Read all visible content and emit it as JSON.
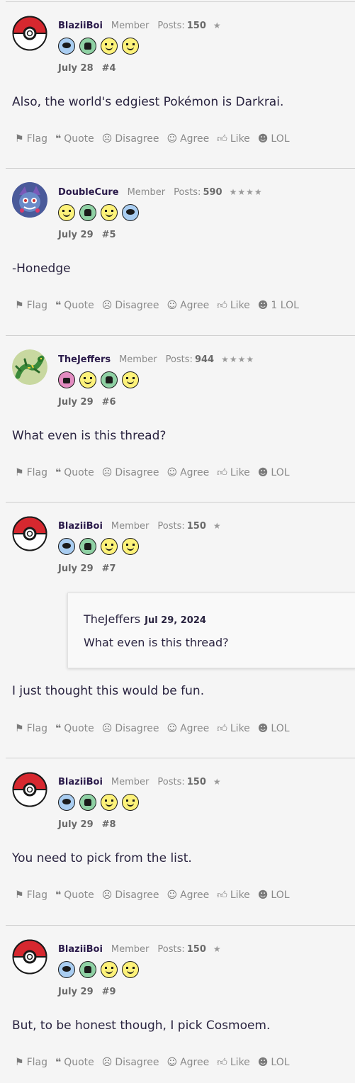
{
  "actions": {
    "flag": "Flag",
    "quote": "Quote",
    "disagree": "Disagree",
    "agree": "Agree",
    "like": "Like",
    "lol": "LOL",
    "lol_counted": "1 LOL"
  },
  "posts": [
    {
      "username": "BlaziiBoi",
      "role": "Member",
      "posts_label": "Posts:",
      "posts_count": "150",
      "stars": "★",
      "badges": [
        "speech-bubble-icon",
        "thumbs-up-icon",
        "wink-face-icon",
        "smile-face-icon"
      ],
      "date": "July 28",
      "number": "#4",
      "body": "Also, the world's edgiest Pokémon is Darkrai."
    },
    {
      "username": "DoubleCure",
      "role": "Member",
      "posts_label": "Posts:",
      "posts_count": "590",
      "stars": "★★★★",
      "badges": [
        "wink-face-icon",
        "thumbs-up-icon",
        "smile-face-icon",
        "speech-bubble-icon"
      ],
      "date": "July 29",
      "number": "#5",
      "body": "-Honedge"
    },
    {
      "username": "TheJeffers",
      "role": "Member",
      "posts_label": "Posts:",
      "posts_count": "944",
      "stars": "★★★★",
      "badges": [
        "cake-icon",
        "wink-face-icon",
        "thumbs-up-icon",
        "smile-face-icon"
      ],
      "date": "July 29",
      "number": "#6",
      "body": "What even is this thread?"
    },
    {
      "username": "BlaziiBoi",
      "role": "Member",
      "posts_label": "Posts:",
      "posts_count": "150",
      "stars": "★",
      "badges": [
        "speech-bubble-icon",
        "thumbs-up-icon",
        "wink-face-icon",
        "smile-face-icon"
      ],
      "date": "July 29",
      "number": "#7",
      "quote": {
        "author": "TheJeffers",
        "date": "Jul 29, 2024",
        "text": "What even is this thread?"
      },
      "body": "I just thought this would be fun."
    },
    {
      "username": "BlaziiBoi",
      "role": "Member",
      "posts_label": "Posts:",
      "posts_count": "150",
      "stars": "★",
      "badges": [
        "speech-bubble-icon",
        "thumbs-up-icon",
        "wink-face-icon",
        "smile-face-icon"
      ],
      "date": "July 29",
      "number": "#8",
      "body": "You need to pick from the list."
    },
    {
      "username": "BlaziiBoi",
      "role": "Member",
      "posts_label": "Posts:",
      "posts_count": "150",
      "stars": "★",
      "badges": [
        "speech-bubble-icon",
        "thumbs-up-icon",
        "wink-face-icon",
        "smile-face-icon"
      ],
      "date": "July 29",
      "number": "#9",
      "body": "But, to be honest though, I pick Cosmoem."
    }
  ],
  "colors": {
    "background": "#f5f5f5",
    "username": "#2a1a4a",
    "text": "#2a2440",
    "muted": "#8a8a8a",
    "pokeball_red": "#d6282f"
  }
}
